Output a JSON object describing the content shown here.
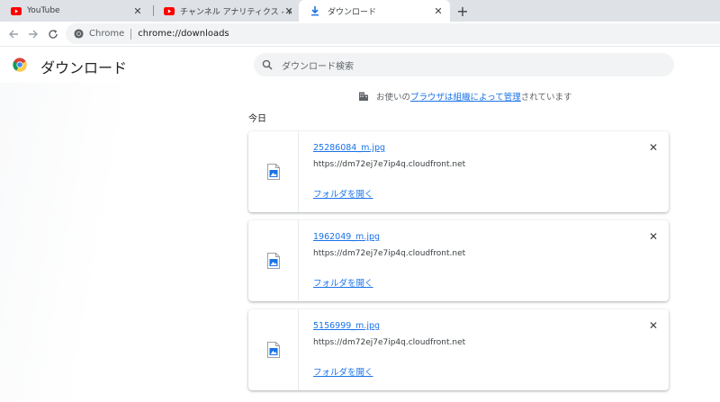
{
  "tabs": [
    {
      "title": "YouTube",
      "icon": "youtube-icon"
    },
    {
      "title": "チャンネル アナリティクス - YouTube",
      "icon": "youtube-icon"
    },
    {
      "title": "ダウンロード",
      "icon": "download-icon"
    }
  ],
  "omnibox": {
    "site_label": "Chrome",
    "url": "chrome://downloads"
  },
  "page": {
    "title": "ダウンロード"
  },
  "search": {
    "placeholder": "ダウンロード検索"
  },
  "managed": {
    "prefix": "お使いの",
    "link1": "ブラウザは組織によって管理",
    "suffix": "されています"
  },
  "date_header": "今日",
  "downloads": [
    {
      "file_name": "25286084_m.jpg",
      "url": "https://dm72ej7e7ip4q.cloudfront.net",
      "action": "フォルダを開く"
    },
    {
      "file_name": "1962049_m.jpg",
      "url": "https://dm72ej7e7ip4q.cloudfront.net",
      "action": "フォルダを開く"
    },
    {
      "file_name": "5156999_m.jpg",
      "url": "https://dm72ej7e7ip4q.cloudfront.net",
      "action": "フォルダを開く"
    }
  ],
  "colors": {
    "accent": "#1a73e8",
    "youtube_red": "#ff0000",
    "tabbar": "#dee1e6"
  }
}
